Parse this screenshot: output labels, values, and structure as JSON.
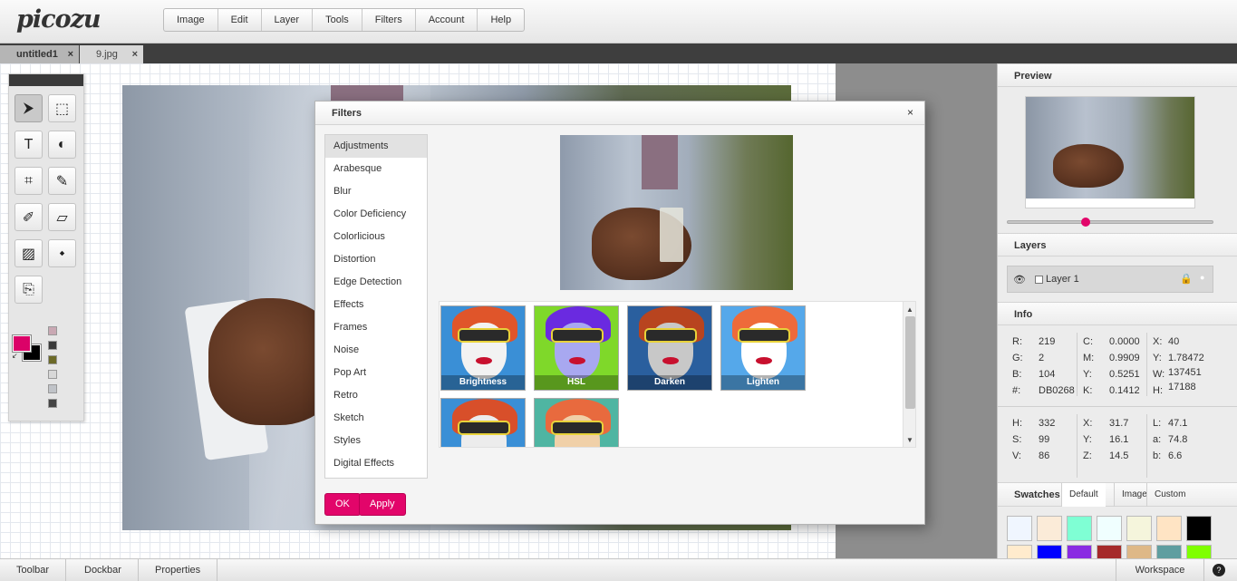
{
  "app": {
    "logo": "picozu"
  },
  "menu": [
    "Image",
    "Edit",
    "Layer",
    "Tools",
    "Filters",
    "Account",
    "Help"
  ],
  "doc_tabs": [
    {
      "name": "untitled1",
      "close": "×"
    },
    {
      "name": "9.jpg",
      "close": "×"
    }
  ],
  "colors": {
    "accent": "#e2056a",
    "foreground": "#DB0268",
    "background": "#000000"
  },
  "toolbar": {
    "tools": [
      {
        "name": "move-tool",
        "glyph": "⮞"
      },
      {
        "name": "marquee-tool",
        "glyph": "⬚"
      },
      {
        "name": "text-tool",
        "glyph": "T"
      },
      {
        "name": "shape-tool",
        "glyph": "◐"
      },
      {
        "name": "crop-tool",
        "glyph": "⌗"
      },
      {
        "name": "brush-tool",
        "glyph": "✎"
      },
      {
        "name": "eyedropper-tool",
        "glyph": "✐"
      },
      {
        "name": "eraser-tool",
        "glyph": "▱"
      },
      {
        "name": "smudge-tool",
        "glyph": "▨"
      },
      {
        "name": "fill-tool",
        "glyph": "⬩"
      },
      {
        "name": "clone-tool",
        "glyph": "⎘"
      }
    ],
    "mini_swatches": [
      "#c9a8b3",
      "#3a3a3a",
      "#6c6a28",
      "#d8d8d8",
      "#c0c3c8",
      "#444444"
    ]
  },
  "filters_dialog": {
    "title": "Filters",
    "close": "×",
    "categories": [
      "Adjustments",
      "Arabesque",
      "Blur",
      "Color Deficiency",
      "Colorlicious",
      "Distortion",
      "Edge Detection",
      "Effects",
      "Frames",
      "Noise",
      "Pop Art",
      "Retro",
      "Sketch",
      "Styles",
      "Digital Effects"
    ],
    "selected_category": "Adjustments",
    "thumbnails": [
      {
        "label": "Brightness",
        "bg": "#3a8fd6",
        "hair": "#e0552a",
        "face": "#f2f2f2"
      },
      {
        "label": "HSL",
        "bg": "#7fd82a",
        "hair": "#6a2ae0",
        "face": "#a8a8f0"
      },
      {
        "label": "Darken",
        "bg": "#2a5f9e",
        "hair": "#b8441f",
        "face": "#c8c8c8"
      },
      {
        "label": "Lighten",
        "bg": "#55a8ea",
        "hair": "#ee6a3a",
        "face": "#ffffff"
      },
      {
        "label": "",
        "bg": "#3a8fd6",
        "hair": "#d84f2a",
        "face": "#ececec"
      },
      {
        "label": "",
        "bg": "#4fb5a2",
        "hair": "#e86a3e",
        "face": "#f0d0a8"
      }
    ],
    "ok_label": "OK",
    "apply_label": "Apply"
  },
  "right": {
    "preview_title": "Preview",
    "layers_title": "Layers",
    "layer_name": "Layer 1",
    "info_title": "Info",
    "info": {
      "R": "219",
      "G": "2",
      "B": "104",
      "hex": "DB0268",
      "C": "0.0000",
      "M": "0.9909",
      "Y": "0.5251",
      "K": "0.1412",
      "X": "40",
      "Y2": "1.78472",
      "W": "137451",
      "H": "17188",
      "Hue": "332",
      "S": "99",
      "V": "86",
      "X3": "31.7",
      "Y3": "16.1",
      "Z": "14.5",
      "L": "47.1",
      "a": "74.8",
      "b": "6.6"
    },
    "info_labels": {
      "R": "R:",
      "G": "G:",
      "B": "B:",
      "hex": "#:",
      "C": "C:",
      "M": "M:",
      "Y": "Y:",
      "K": "K:",
      "X": "X:",
      "Y2": "Y:",
      "W": "W:",
      "H": "H:",
      "Hue": "H:",
      "S": "S:",
      "V": "V:",
      "X3": "X:",
      "Y3": "Y:",
      "Z": "Z:",
      "L": "L:",
      "a": "a:",
      "b": "b:"
    },
    "swatches_title": "Swatches",
    "swatch_tabs": [
      "Default",
      "Image",
      "Custom"
    ],
    "swatches": [
      "#f0f6ff",
      "#fbebd8",
      "#7fffd4",
      "#f0ffff",
      "#f5f5dc",
      "#ffe4c4",
      "#000000",
      "#ffebcd",
      "#0000ff",
      "#8a2be2",
      "#a52a2a",
      "#deb887",
      "#5f9ea0",
      "#7fff00"
    ]
  },
  "bottom": {
    "toolbar": "Toolbar",
    "dockbar": "Dockbar",
    "properties": "Properties",
    "workspace": "Workspace",
    "help": "?"
  }
}
